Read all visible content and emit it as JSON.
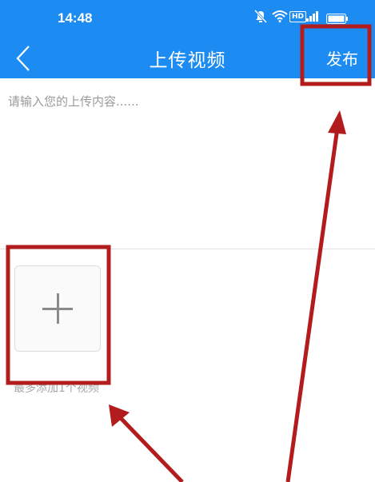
{
  "status_bar": {
    "time": "14:48",
    "icons": [
      "mute-icon",
      "wifi-icon",
      "hd-icon",
      "signal-icon",
      "battery-icon"
    ],
    "hd_label": "HD"
  },
  "header": {
    "title": "上传视频",
    "publish_label": "发布",
    "back_icon": "chevron-left-icon"
  },
  "composer": {
    "placeholder": "请输入您的上传内容......",
    "value": ""
  },
  "media": {
    "add_icon": "plus-icon",
    "hint": "最多添加1个视频"
  },
  "colors": {
    "header_bg": "#1d8cf2",
    "annotation": "#b31c1c"
  }
}
